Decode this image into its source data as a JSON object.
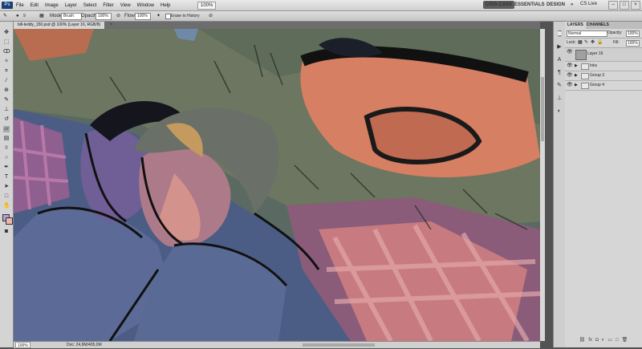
{
  "app": {
    "logo": "Ps",
    "menus": [
      "File",
      "Edit",
      "Image",
      "Layer",
      "Select",
      "Filter",
      "View",
      "Window",
      "Help"
    ],
    "zoom": "100%",
    "workspaces": [
      "CRIS-CASA",
      "ESSENTIALS",
      "DESIGN"
    ],
    "more": "»",
    "cs_live": "CS Live",
    "window_buttons": [
      "–",
      "□",
      "×"
    ]
  },
  "options_bar": {
    "brush_size": "9",
    "mode_label": "Mode:",
    "mode_value": "Brush",
    "opacity_label": "Opacity:",
    "opacity_value": "100%",
    "flow_label": "Flow:",
    "flow_value": "100%",
    "erase_history_label": "Erase to History"
  },
  "document": {
    "tab_title": "bill-teddy_150.psd @ 100% (Layer 16, RGB/8)",
    "close": "×"
  },
  "status": {
    "zoom": "100%",
    "doc_info": "Doc: 24,9M/405,0M"
  },
  "layers_panel": {
    "tabs": [
      "LAYERS",
      "CHANNELS"
    ],
    "blend_mode": "Normal",
    "opacity_label": "Opacity:",
    "opacity_value": "100%",
    "lock_label": "Lock:",
    "fill_label": "Fill:",
    "fill_value": "100%",
    "layers": [
      {
        "name": "Layer 16",
        "selected": true,
        "visible": true
      },
      {
        "name": "Inks",
        "selected": false,
        "visible": true
      },
      {
        "name": "Group 3",
        "selected": false,
        "visible": true
      },
      {
        "name": "Group 4",
        "selected": false,
        "visible": true
      }
    ]
  },
  "colors": {
    "foreground": "#b6a2d8",
    "background": "#e6b8b0"
  }
}
